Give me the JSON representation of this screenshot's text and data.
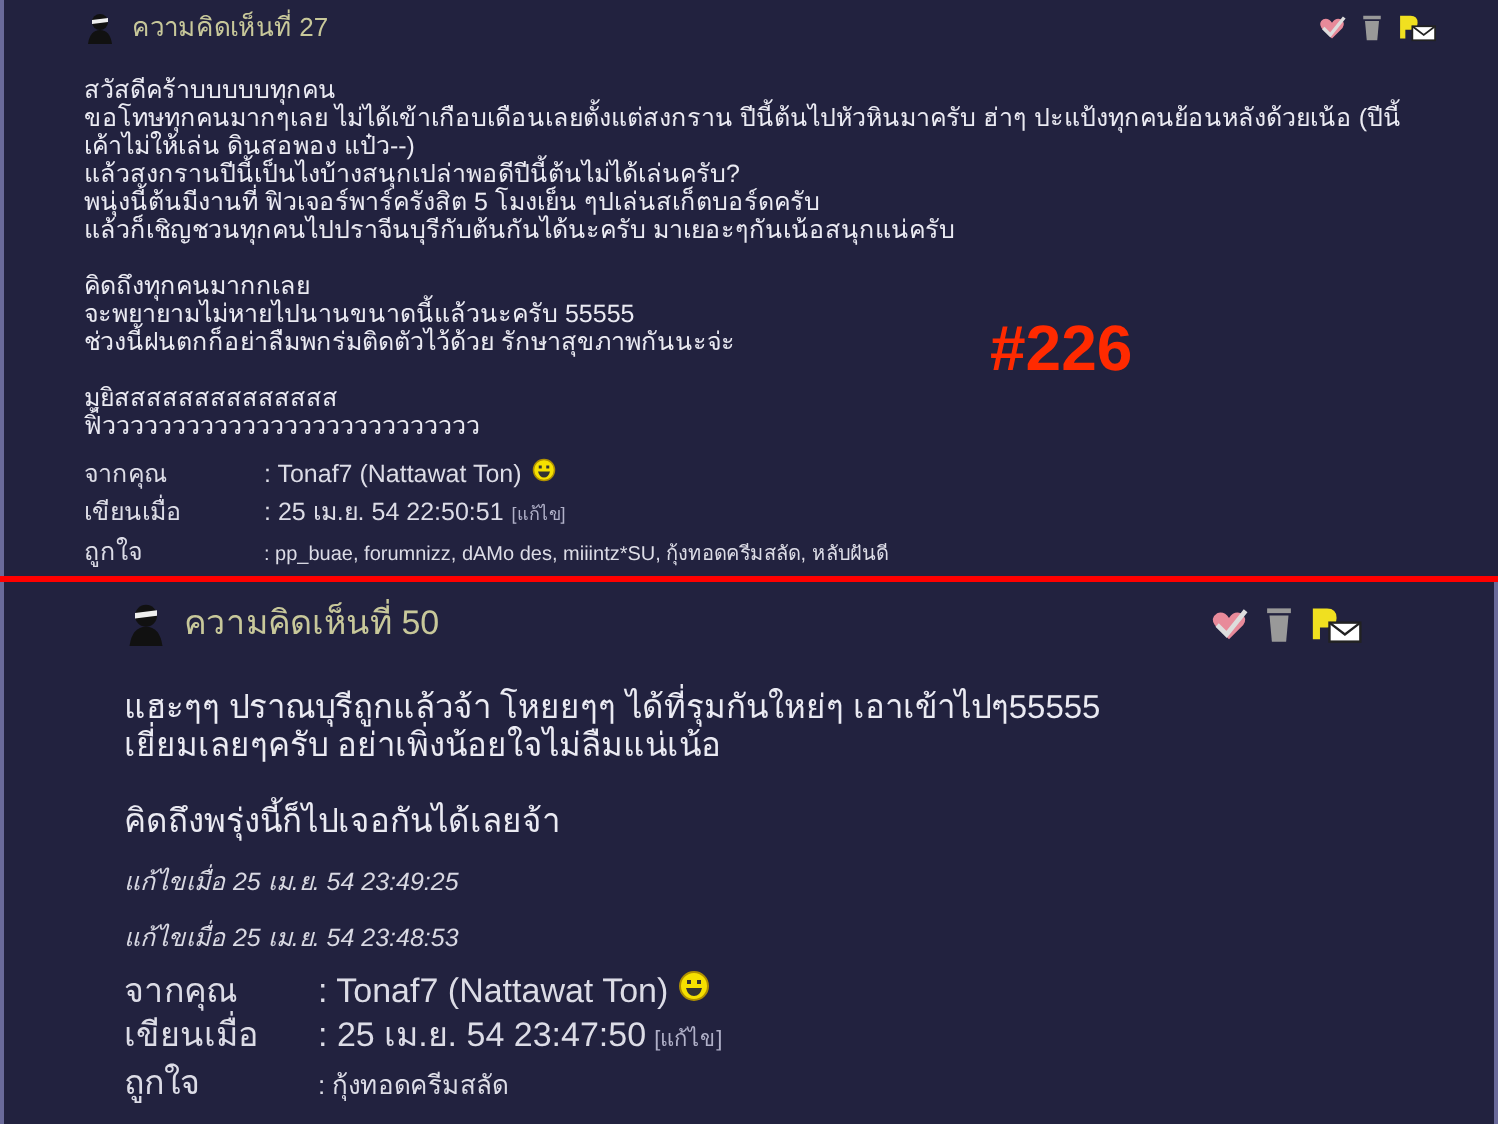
{
  "posts": [
    {
      "kind": "small",
      "title": "ความคิดเห็นที่ 27",
      "paragraphs": [
        [
          "สวัสดีคร้าบบบบบทุกคน",
          "ขอโทษทุกคนมากๆเลย ไม่ได้เข้าเกือบเดือนเลยตั้งแต่สงกราน ปีนี้ต้นไปหัวหินมาครับ ฮ่าๆ ปะแป้งทุกคนย้อนหลังด้วยเน้อ (ปีนี้เค้าไม่ให้เล่น ดินสอพอง แป๋ว--)",
          "แล้วสงกรานปีนี้เป็นไงบ้างสนุกเปล่าพอดีปีนี้ต้นไม่ได้เล่นครับ?",
          "พนุ่งนี้ต้นมีงานที่ ฟิวเจอร์พาร์ครังสิต 5 โมงเย็น ๆปเล่นสเก็ตบอร์ดครับ",
          "แล้วก็เชิญชวนทุกคนไปปราจีนบุรีกับต้นกันได้นะครับ มาเยอะๆกันเน้อสนุกแน่ครับ"
        ],
        [
          "คิดถึงทุกคนมากกเลย",
          "จะพยายามไม่หายไปนานขนาดนี้แล้วนะครับ 55555",
          "ช่วงนี้ฝนตกก็อย่าลืมพกร่มติดตัวไว้ด้วย รักษาสุขภาพกันนะจ่ะ"
        ],
        [
          "มุยิสสสสสสสสสสสสสส",
          "ฟิ้ววววววววววววววววววววววววววว"
        ]
      ],
      "meta": [
        {
          "label": "จากคุณ",
          "value": ": Tonaf7 (Nattawat Ton)",
          "smiley": true
        },
        {
          "label": "เขียนเมื่อ",
          "value": ": 25 เม.ย. 54 22:50:51",
          "link": "[แก้ไข]"
        },
        {
          "label": "ถูกใจ",
          "value": ": pp_buae, forumnizz, dAMo des, miiintz*SU, กุ้งทอดครีมสลัด, หลับฝันดี",
          "small": true
        }
      ]
    },
    {
      "kind": "large",
      "title": "ความคิดเห็นที่ 50",
      "paragraphs": [
        [
          "แฮะๆๆ ปราณบุรีถูกแล้วจ้า โหยยๆๆ ได้ที่รุมกันใหย่ๆ เอาเข้าไปๆ55555",
          "เยี่ยมเลยๆครับ อย่าเพิ่งน้อยใจไม่ลืมแน่เน้อ"
        ],
        [
          "คิดถึงพรุ่งนี้ก็ไปเจอกันได้เลยจ้า"
        ]
      ],
      "edits": [
        "แก้ไขเมื่อ 25 เม.ย. 54 23:49:25",
        "แก้ไขเมื่อ 25 เม.ย. 54 23:48:53"
      ],
      "meta": [
        {
          "label": "จากคุณ",
          "value": ": Tonaf7 (Nattawat Ton)",
          "smiley": true
        },
        {
          "label": "เขียนเมื่อ",
          "value": ": 25 เม.ย. 54 23:47:50",
          "link": "[แก้ไข]"
        },
        {
          "label": "ถูกใจ",
          "value": ": กุ้งทอดครีมสลัด",
          "small": true
        }
      ]
    }
  ],
  "overlay_label": "#226"
}
